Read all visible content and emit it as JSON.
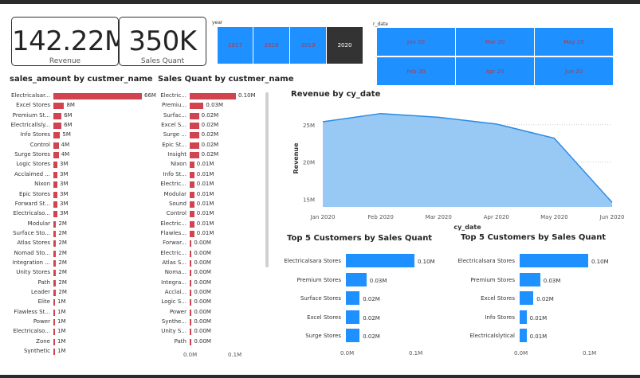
{
  "cards": [
    {
      "value": "142.22M",
      "label": "Revenue"
    },
    {
      "value": "350K",
      "label": "Sales Quant"
    }
  ],
  "year_slicer": {
    "title": "year",
    "options": [
      "2017",
      "2018",
      "2019",
      "2020"
    ],
    "selected": "2020"
  },
  "date_slicer": {
    "title": "r_date",
    "options": [
      "Jan 20",
      "Mar 20",
      "May 20",
      "Feb 20",
      "Apr 20",
      "Jun 20"
    ]
  },
  "colors": {
    "red_bar": "#d0434f",
    "blue": "#1e90ff",
    "area": "#98c9f4",
    "area_line": "#2a8ae6"
  },
  "sales_amount": {
    "title": "sales_amount by custmer_name",
    "max": 66,
    "rows": [
      {
        "label": "Electricalsar...",
        "value": 66,
        "text": "66M"
      },
      {
        "label": "Excel Stores",
        "value": 8,
        "text": "8M"
      },
      {
        "label": "Premium St...",
        "value": 6,
        "text": "6M"
      },
      {
        "label": "Electricallsly...",
        "value": 6,
        "text": "6M"
      },
      {
        "label": "Info Stores",
        "value": 5,
        "text": "5M"
      },
      {
        "label": "Control",
        "value": 4,
        "text": "4M"
      },
      {
        "label": "Surge Stores",
        "value": 4,
        "text": "4M"
      },
      {
        "label": "Logic Stores",
        "value": 3,
        "text": "3M"
      },
      {
        "label": "Acclaimed ...",
        "value": 3,
        "text": "3M"
      },
      {
        "label": "Nixon",
        "value": 3,
        "text": "3M"
      },
      {
        "label": "Epic Stores",
        "value": 3,
        "text": "3M"
      },
      {
        "label": "Forward St...",
        "value": 3,
        "text": "3M"
      },
      {
        "label": "Electricalso...",
        "value": 3,
        "text": "3M"
      },
      {
        "label": "Modular",
        "value": 2,
        "text": "2M"
      },
      {
        "label": "Surface Sto...",
        "value": 2,
        "text": "2M"
      },
      {
        "label": "Atlas Stores",
        "value": 2,
        "text": "2M"
      },
      {
        "label": "Nomad Sto...",
        "value": 2,
        "text": "2M"
      },
      {
        "label": "Integration ...",
        "value": 2,
        "text": "2M"
      },
      {
        "label": "Unity Stores",
        "value": 2,
        "text": "2M"
      },
      {
        "label": "Path",
        "value": 2,
        "text": "2M"
      },
      {
        "label": "Leader",
        "value": 2,
        "text": "2M"
      },
      {
        "label": "Elite",
        "value": 1,
        "text": "1M"
      },
      {
        "label": "Flawless St...",
        "value": 1,
        "text": "1M"
      },
      {
        "label": "Power",
        "value": 1,
        "text": "1M"
      },
      {
        "label": "Electricalso...",
        "value": 1,
        "text": "1M"
      },
      {
        "label": "Zone",
        "value": 1,
        "text": "1M"
      },
      {
        "label": "Synthetic",
        "value": 1,
        "text": "1M"
      }
    ]
  },
  "sales_quant": {
    "title": "Sales Quant by custmer_name",
    "max": 0.1,
    "ticks": [
      "0.0M",
      "0.1M"
    ],
    "rows": [
      {
        "label": "Electric...",
        "value": 0.1,
        "text": "0.10M"
      },
      {
        "label": "Premiu...",
        "value": 0.03,
        "text": "0.03M"
      },
      {
        "label": "Surfac...",
        "value": 0.02,
        "text": "0.02M"
      },
      {
        "label": "Excel S...",
        "value": 0.02,
        "text": "0.02M"
      },
      {
        "label": "Surge ...",
        "value": 0.02,
        "text": "0.02M"
      },
      {
        "label": "Epic St...",
        "value": 0.02,
        "text": "0.02M"
      },
      {
        "label": "Insight",
        "value": 0.02,
        "text": "0.02M"
      },
      {
        "label": "Nixon",
        "value": 0.01,
        "text": "0.01M"
      },
      {
        "label": "Info St...",
        "value": 0.01,
        "text": "0.01M"
      },
      {
        "label": "Electric...",
        "value": 0.01,
        "text": "0.01M"
      },
      {
        "label": "Modular",
        "value": 0.01,
        "text": "0.01M"
      },
      {
        "label": "Sound",
        "value": 0.01,
        "text": "0.01M"
      },
      {
        "label": "Control",
        "value": 0.01,
        "text": "0.01M"
      },
      {
        "label": "Electric...",
        "value": 0.01,
        "text": "0.01M"
      },
      {
        "label": "Flawles...",
        "value": 0.01,
        "text": "0.01M"
      },
      {
        "label": "Forwar...",
        "value": 0.004,
        "text": "0.00M"
      },
      {
        "label": "Electric...",
        "value": 0.004,
        "text": "0.00M"
      },
      {
        "label": "Atlas S...",
        "value": 0.004,
        "text": "0.00M"
      },
      {
        "label": "Noma...",
        "value": 0.004,
        "text": "0.00M"
      },
      {
        "label": "Integra...",
        "value": 0.004,
        "text": "0.00M"
      },
      {
        "label": "Acclai...",
        "value": 0.004,
        "text": "0.00M"
      },
      {
        "label": "Logic S...",
        "value": 0.004,
        "text": "0.00M"
      },
      {
        "label": "Power",
        "value": 0.004,
        "text": "0.00M"
      },
      {
        "label": "Synthe...",
        "value": 0.004,
        "text": "0.00M"
      },
      {
        "label": "Unity S...",
        "value": 0.004,
        "text": "0.00M"
      },
      {
        "label": "Path",
        "value": 0.004,
        "text": "0.00M"
      }
    ]
  },
  "chart_data": [
    {
      "type": "area",
      "title": "Revenue by cy_date",
      "xlabel": "cy_date",
      "ylabel": "Revenue",
      "x": [
        "Jan 2020",
        "Feb 2020",
        "Mar 2020",
        "Apr 2020",
        "May 2020",
        "Jun 2020"
      ],
      "values": [
        25.4,
        26.5,
        26.0,
        25.1,
        23.2,
        14.6
      ],
      "yticks": [
        "25M",
        "20M",
        "15M"
      ],
      "ylim": [
        14,
        27
      ],
      "grid": true
    },
    {
      "type": "bar",
      "title": "Top 5 Customers by Sales Quant",
      "categories": [
        "Electricalsara Stores",
        "Premium Stores",
        "Surface Stores",
        "Excel Stores",
        "Surge Stores"
      ],
      "values": [
        0.1,
        0.03,
        0.02,
        0.02,
        0.02
      ],
      "value_labels": [
        "0.10M",
        "0.03M",
        "0.02M",
        "0.02M",
        "0.02M"
      ],
      "xticks": [
        "0.0M",
        "0.1M"
      ],
      "xlim": [
        0,
        0.1
      ]
    },
    {
      "type": "bar",
      "title": "Top 5 Customers by Sales Quant",
      "categories": [
        "Electricalsara Stores",
        "Premium Stores",
        "Excel Stores",
        "Info Stores",
        "Electricalslytical"
      ],
      "values": [
        0.1,
        0.03,
        0.02,
        0.01,
        0.01
      ],
      "value_labels": [
        "0.10M",
        "0.03M",
        "0.02M",
        "0.01M",
        "0.01M"
      ],
      "xticks": [
        "0.0M",
        "0.1M"
      ],
      "xlim": [
        0,
        0.1
      ]
    }
  ]
}
